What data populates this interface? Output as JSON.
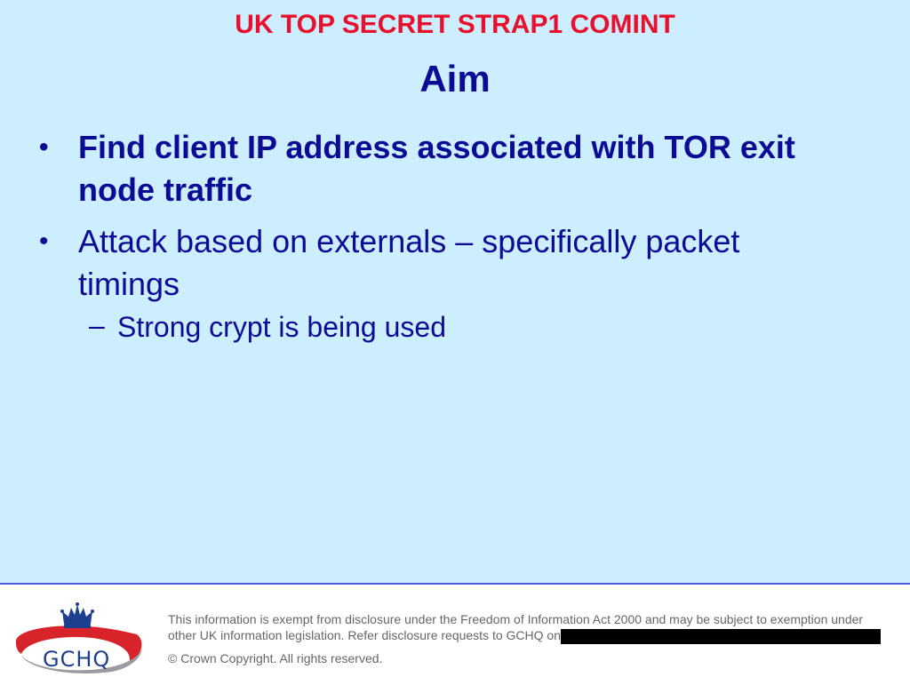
{
  "slide": {
    "classification": "UK TOP SECRET STRAP1 COMINT",
    "title": "Aim",
    "bullets": [
      {
        "marker": "•",
        "text": "Find client IP address associated with TOR exit node traffic"
      },
      {
        "marker": "•",
        "text": "Attack based on externals – specifically packet timings"
      }
    ],
    "sub_bullet": {
      "marker": "–",
      "text": "Strong crypt is being used"
    }
  },
  "footer": {
    "logo_text": "GCHQ",
    "foi_notice": "This information is exempt from disclosure under the Freedom of Information Act 2000 and may be subject to exemption under other UK information legislation. Refer disclosure requests to GCHQ on",
    "copyright": "© Crown Copyright. All rights reserved."
  },
  "colors": {
    "classification": "#e8112d",
    "text": "#0b0b96",
    "background": "#cceeff",
    "divider": "#4d5bd8"
  },
  "icons": {
    "logo": "gchq-crown-logo"
  }
}
